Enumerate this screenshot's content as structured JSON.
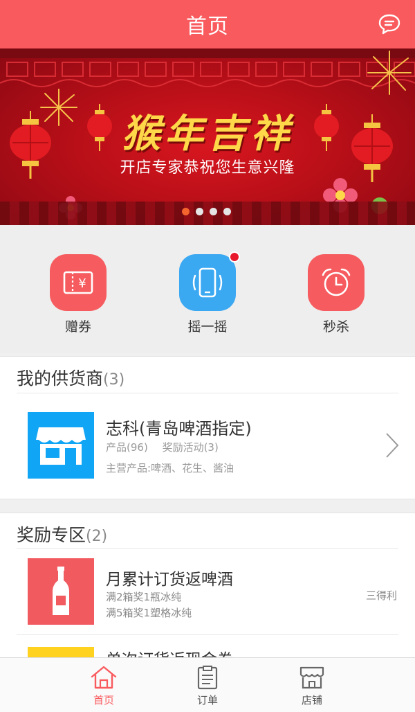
{
  "header": {
    "title": "首页",
    "message_icon": "chat-bubble-icon"
  },
  "banner": {
    "title": "猴年吉祥",
    "subtitle": "开店专家恭祝您生意兴隆",
    "carousel": {
      "count": 4,
      "active_index": 0
    }
  },
  "quick_actions": [
    {
      "label": "赠券",
      "icon": "coupon-icon",
      "color": "#f65c5f",
      "badge": false
    },
    {
      "label": "摇一摇",
      "icon": "phone-shake-icon",
      "color": "#3ba8f2",
      "badge": true
    },
    {
      "label": "秒杀",
      "icon": "alarm-clock-icon",
      "color": "#f65c5f",
      "badge": false
    }
  ],
  "suppliers": {
    "heading": "我的供货商",
    "count": "(3)",
    "item": {
      "name": "志科(青岛啤酒指定)",
      "products": "产品(96)",
      "activities": "奖励活动(3)",
      "main_products": "主营产品:啤酒、花生、酱油"
    }
  },
  "rewards": {
    "heading": "奖励专区",
    "count": "(2)",
    "items": [
      {
        "title": "月累计订货返啤酒",
        "line1": "满2箱奖1瓶冰纯",
        "line2": "满5箱奖1塑格冰纯",
        "tag": "三得利",
        "thumb_color": "#f15a5f"
      },
      {
        "title": "单次订货返现金券",
        "thumb_color": "#ffd21f"
      }
    ]
  },
  "tabbar": {
    "tabs": [
      {
        "label": "首页",
        "icon": "home-icon",
        "active": true
      },
      {
        "label": "订单",
        "icon": "order-list-icon",
        "active": false
      },
      {
        "label": "店铺",
        "icon": "store-icon",
        "active": false
      }
    ]
  },
  "colors": {
    "primary": "#f95a5d",
    "blue": "#3ba8f2",
    "supplier_blue": "#10a5f5",
    "yellow": "#ffd21f"
  }
}
